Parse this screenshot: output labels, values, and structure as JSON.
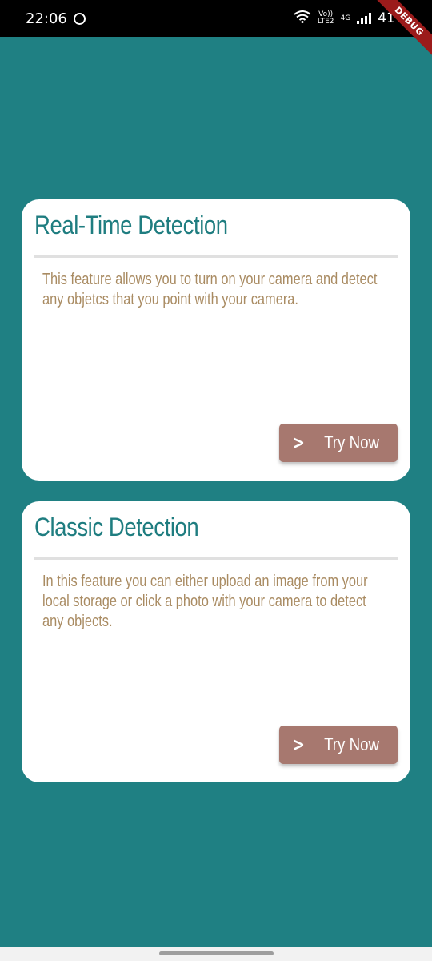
{
  "status_bar": {
    "time": "22:06",
    "volte_top": "Vo))",
    "volte_bottom": "LTE2",
    "network": "4G",
    "battery": "41%",
    "debug_label": "DEBUG"
  },
  "cards": [
    {
      "title": "Real-Time Detection",
      "description": "This feature allows you to turn on your camera and detect any objetcs that you point with your camera.",
      "button_label": "Try Now",
      "button_icon": "chevron-right-icon"
    },
    {
      "title": "Classic Detection",
      "description": "In this feature you can either upload an image from your local storage or click a photo with your camera to detect any objects.",
      "button_label": "Try Now",
      "button_icon": "chevron-right-icon"
    }
  ],
  "colors": {
    "background": "#1F8083",
    "card": "#FFFFFF",
    "title": "#1F7D80",
    "description": "#A98B62",
    "button": "#A7786F"
  }
}
